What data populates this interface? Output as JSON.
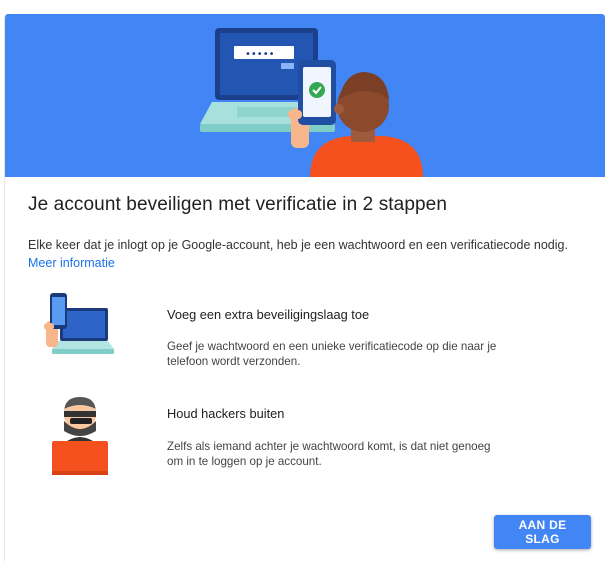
{
  "header": {
    "password_mask": "•••••",
    "illustration": "laptop-phone-verification-illustration"
  },
  "main": {
    "title": "Je account beveiligen met verificatie in 2 stappen",
    "description": "Elke keer dat je inlogt op je Google-account, heb je een wachtwoord en een verificatiecode nodig.",
    "learn_more": "Meer informatie"
  },
  "features": [
    {
      "icon": "phone-laptop-icon",
      "title": "Voeg een extra beveiligingslaag toe",
      "description": "Geef je wachtwoord en een unieke verificatiecode op die naar je telefoon wordt verzonden."
    },
    {
      "icon": "hacker-icon",
      "title": "Houd hackers buiten",
      "description": "Zelfs als iemand achter je wachtwoord komt, is dat niet genoeg om in te loggen op je account."
    }
  ],
  "actions": {
    "start_label": "AAN DE SLAG"
  },
  "colors": {
    "brand_blue": "#4285f4",
    "link_blue": "#1a73e8",
    "banner_person_shirt": "#f4511e"
  }
}
